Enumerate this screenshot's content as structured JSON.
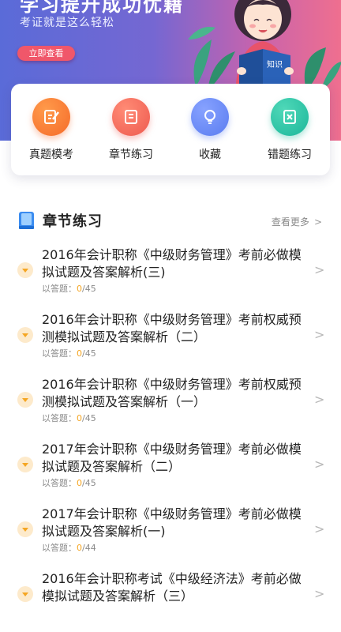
{
  "banner": {
    "title": "学习提升成功优籍",
    "subtitle": "考证就是这么轻松",
    "button_label": "立即查看",
    "book_text": "知识"
  },
  "menu": [
    {
      "label": "真题模考",
      "icon": "edit-icon",
      "color": "#f56b2a"
    },
    {
      "label": "章节练习",
      "icon": "book-icon",
      "color": "#ee5a4f"
    },
    {
      "label": "收藏",
      "icon": "lightbulb-icon",
      "color": "#5a7cf0"
    },
    {
      "label": "错题练习",
      "icon": "error-notebook-icon",
      "color": "#1cb79a"
    }
  ],
  "section": {
    "title": "章节练习",
    "more_label": "查看更多",
    "more_chevron": ">",
    "icon": "book-icon"
  },
  "answered_label": "以答题：",
  "chevron": ">",
  "items": [
    {
      "title": "2016年会计职称《中级财务管理》考前必做模拟试题及答案解析(三)",
      "done": "0",
      "total": "/45"
    },
    {
      "title": "2016年会计职称《中级财务管理》考前权威预测模拟试题及答案解析（二）",
      "done": "0",
      "total": "/45"
    },
    {
      "title": "2016年会计职称《中级财务管理》考前权威预测模拟试题及答案解析（一）",
      "done": "0",
      "total": "/45"
    },
    {
      "title": "2017年会计职称《中级财务管理》考前必做模拟试题及答案解析（二）",
      "done": "0",
      "total": "/45"
    },
    {
      "title": "2017年会计职称《中级财务管理》考前必做模拟试题及答案解析(一)",
      "done": "0",
      "total": "/44"
    },
    {
      "title": "2016年会计职称考试《中级经济法》考前必做模拟试题及答案解析（三）",
      "done": "",
      "total": ""
    }
  ]
}
